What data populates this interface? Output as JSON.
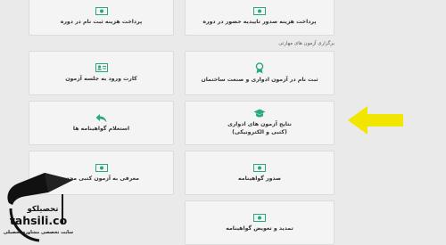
{
  "section_title": "برگزاری آزمون های مهارتی",
  "cards": {
    "pay_exam_fee": {
      "label": "پرداخت هزینه ثبت نام در دوره"
    },
    "pay_cert_fee": {
      "label": "پرداخت هزینه صدور تاییدیه حضور در دوره"
    },
    "entry_card": {
      "label": "کارت ورود به جلسه آزمون"
    },
    "register_periodic": {
      "label": "ثبت نام در آزمون ادواری و صنعت ساختمان"
    },
    "results": {
      "label": "نتایج آزمون های ادواری",
      "sublabel": "(کتبی و الکترونیکی)"
    },
    "retrieve_cert": {
      "label": "استعلام گواهینامه ها"
    },
    "reintroduce": {
      "label": "معرفی به آزمون کتبی مجدد"
    },
    "issue_cert": {
      "label": "صدور گواهینامه"
    },
    "renew_cert": {
      "label": "تمدید و تعویض گواهینامه"
    }
  },
  "icons": {
    "money": "money-icon",
    "id_card": "id-card-icon",
    "award": "award-icon",
    "graduation": "graduation-cap-icon",
    "reply": "reply-arrow-icon"
  },
  "colors": {
    "icon": "#28a97a",
    "arrow": "#f2e600"
  },
  "watermark": {
    "brand_fa": "تحصیلکو",
    "brand_en": "tahsili.co",
    "tagline": "سایت تخصصی مشاوره تحصیلی"
  }
}
